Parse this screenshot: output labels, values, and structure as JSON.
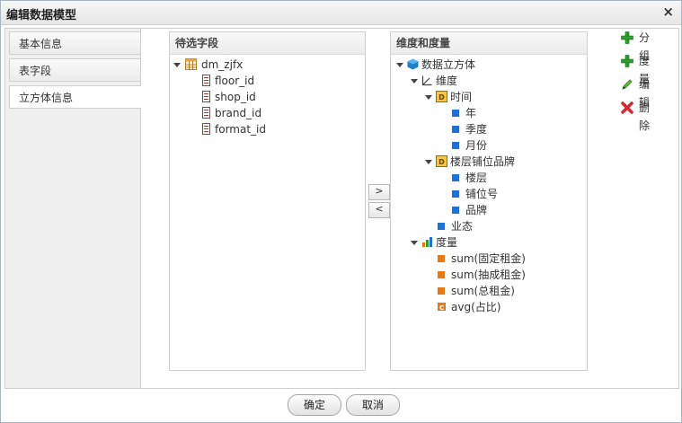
{
  "window": {
    "title": "编辑数据模型",
    "close": "×"
  },
  "tabs": [
    {
      "label": "基本信息"
    },
    {
      "label": "表字段"
    },
    {
      "label": "立方体信息"
    }
  ],
  "left_panel": {
    "title": "待选字段",
    "table": "dm_zjfx",
    "fields": [
      "floor_id",
      "shop_id",
      "brand_id",
      "format_id"
    ]
  },
  "move": {
    "right": ">",
    "left": "<"
  },
  "right_panel": {
    "title": "维度和度量",
    "root": "数据立方体",
    "dimension_group": "维度",
    "time": {
      "label": "时间",
      "items": [
        "年",
        "季度",
        "月份"
      ]
    },
    "floor": {
      "label": "楼层铺位品牌",
      "items": [
        "楼层",
        "铺位号",
        "品牌"
      ]
    },
    "format": "业态",
    "measure_group": "度量",
    "measures": [
      "sum(固定租金)",
      "sum(抽成租金)",
      "sum(总租金)",
      "avg(占比)"
    ]
  },
  "actions": [
    "分组",
    "度量",
    "编辑",
    "删除"
  ],
  "footer": {
    "ok": "确定",
    "cancel": "取消"
  },
  "colors": {
    "blue": "#1f6fd8",
    "orange": "#e87a11",
    "green": "#2e9e2e",
    "red": "#d8282b"
  }
}
